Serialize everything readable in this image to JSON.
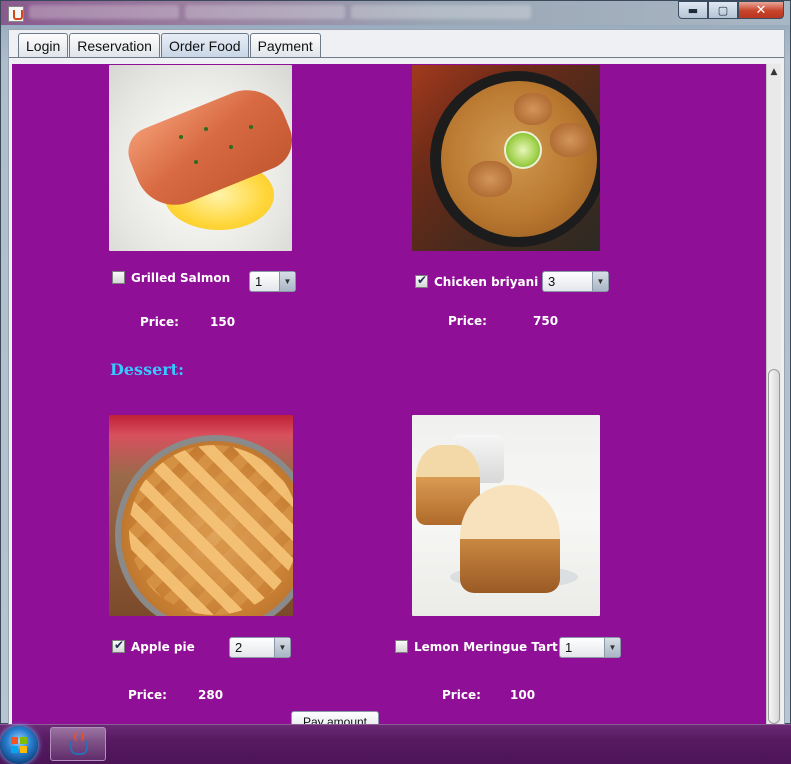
{
  "window": {
    "controls": {
      "minimize": "▬",
      "maximize": "▢",
      "close": "✕"
    }
  },
  "tabs": [
    {
      "label": "Login"
    },
    {
      "label": "Reservation"
    },
    {
      "label": "Order Food",
      "active": true
    },
    {
      "label": "Payment"
    }
  ],
  "main_items": [
    {
      "name": "Grilled Salmon",
      "checked": false,
      "quantity": "1",
      "price_label": "Price:",
      "price": "150"
    },
    {
      "name": "Chicken briyani",
      "checked": true,
      "quantity": "3",
      "price_label": "Price:",
      "price": "750"
    }
  ],
  "dessert_section": {
    "heading": "Dessert:"
  },
  "dessert_items": [
    {
      "name": "Apple pie",
      "checked": true,
      "quantity": "2",
      "price_label": "Price:",
      "price": "280"
    },
    {
      "name": "Lemon Meringue Tart",
      "checked": false,
      "quantity": "1",
      "price_label": "Price:",
      "price": "100"
    }
  ],
  "actions": {
    "pay_amount": "Pay amount"
  },
  "icons": {
    "app": "java-app-icon",
    "scroll_up": "▲",
    "combo_arrow": "▼"
  },
  "colors": {
    "panel_background": "#8f0f97",
    "section_heading": "#38c8ff"
  }
}
